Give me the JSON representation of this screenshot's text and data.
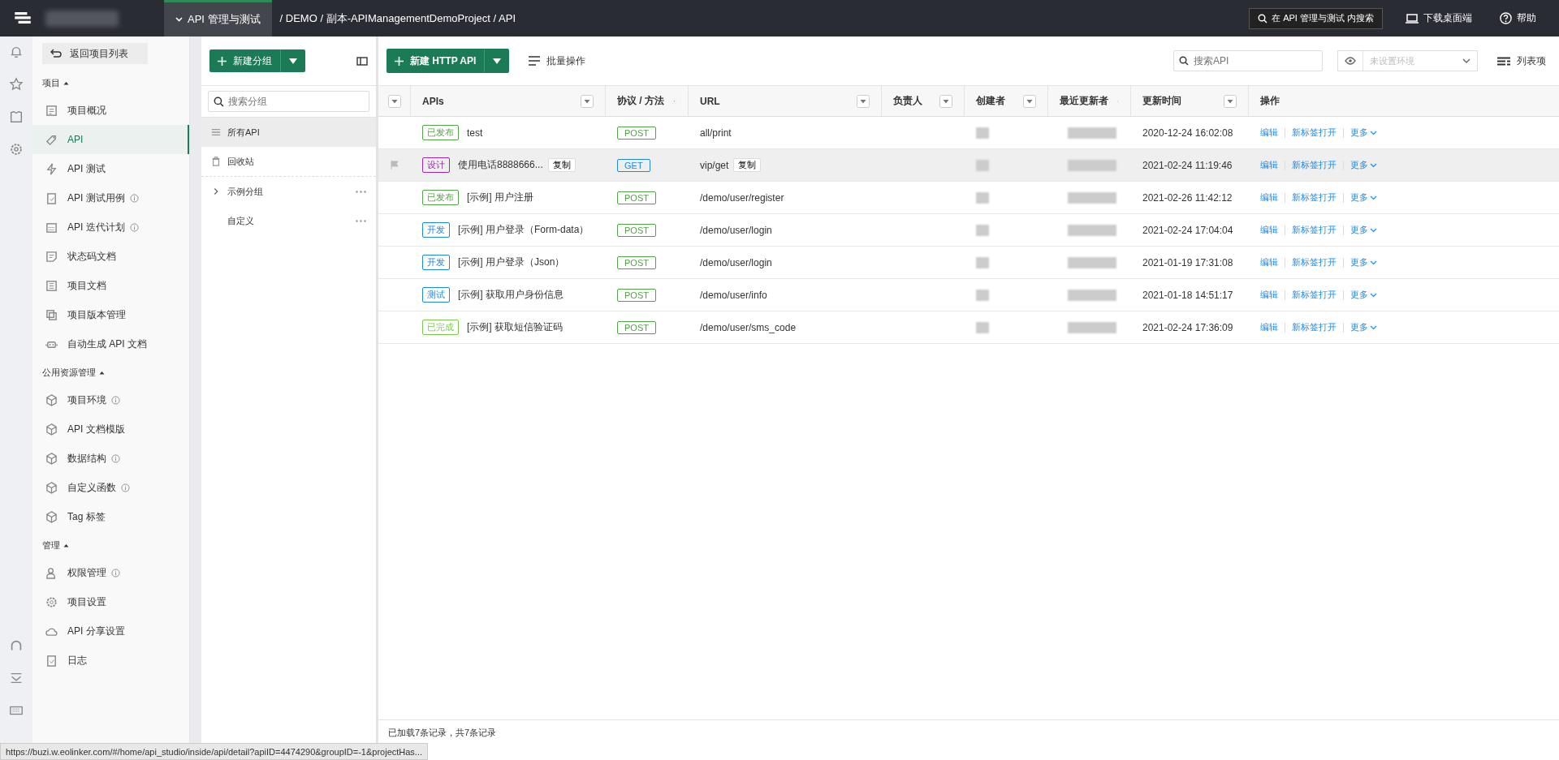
{
  "topbar": {
    "module": "API 管理与测试",
    "breadcrumb": "/ DEMO / 副本-APIManagementDemoProject / API",
    "search": "在 API 管理与测试 内搜索",
    "download": "下载桌面端",
    "help": "帮助"
  },
  "sidebar": {
    "back": "返回项目列表",
    "sections": [
      {
        "title": "项目",
        "items": [
          {
            "label": "项目概况",
            "info": false,
            "selected": false
          },
          {
            "label": "API",
            "info": false,
            "selected": true
          },
          {
            "label": "API 测试",
            "info": false,
            "selected": false
          },
          {
            "label": "API 测试用例",
            "info": true,
            "selected": false
          },
          {
            "label": "API 迭代计划",
            "info": true,
            "selected": false
          },
          {
            "label": "状态码文档",
            "info": false,
            "selected": false
          },
          {
            "label": "项目文档",
            "info": false,
            "selected": false
          },
          {
            "label": "项目版本管理",
            "info": false,
            "selected": false
          },
          {
            "label": "自动生成 API 文档",
            "info": false,
            "selected": false
          }
        ]
      },
      {
        "title": "公用资源管理",
        "items": [
          {
            "label": "项目环境",
            "info": true,
            "selected": false
          },
          {
            "label": "API 文档模版",
            "info": false,
            "selected": false
          },
          {
            "label": "数据结构",
            "info": true,
            "selected": false
          },
          {
            "label": "自定义函数",
            "info": true,
            "selected": false
          },
          {
            "label": "Tag 标签",
            "info": false,
            "selected": false
          }
        ]
      },
      {
        "title": "管理",
        "items": [
          {
            "label": "权限管理",
            "info": true,
            "selected": false
          },
          {
            "label": "项目设置",
            "info": false,
            "selected": false
          },
          {
            "label": "API 分享设置",
            "info": false,
            "selected": false
          },
          {
            "label": "日志",
            "info": false,
            "selected": false
          }
        ]
      }
    ]
  },
  "groups": {
    "new_button": "新建分组",
    "search_placeholder": "搜索分组",
    "items": [
      {
        "label": "所有API",
        "kind": "all",
        "selected": true
      },
      {
        "label": "回收站",
        "kind": "trash",
        "selected": false
      },
      {
        "label": "示例分组",
        "kind": "folder",
        "selected": false
      },
      {
        "label": "自定义",
        "kind": "custom",
        "selected": false
      }
    ]
  },
  "toolbar": {
    "new_api": "新建 HTTP API",
    "batch": "批量操作",
    "search_placeholder": "搜索API",
    "env_placeholder": "未设置环境",
    "columns": "列表项"
  },
  "table": {
    "columns": [
      "APIs",
      "协议 / 方法",
      "URL",
      "负责人",
      "创建者",
      "最近更新者",
      "更新时间",
      "操作"
    ],
    "rows": [
      {
        "selected": false,
        "status": {
          "label": "已发布",
          "color": "#52a447"
        },
        "name": "test",
        "method": {
          "label": "POST",
          "color": "#52a447"
        },
        "url": "all/print",
        "time": "2020-12-24 16:02:08",
        "actions": [
          "编辑",
          "新标签打开",
          "更多"
        ]
      },
      {
        "selected": true,
        "status": {
          "label": "设计",
          "color": "#9c27b0"
        },
        "name": "使用电话8888666...",
        "name_copy": "复制",
        "method": {
          "label": "GET",
          "color": "#1e88e5"
        },
        "url": "vip/get",
        "url_copy": "复制",
        "time": "2021-02-24 11:19:46",
        "actions": [
          "编辑",
          "新标签打开",
          "更多"
        ]
      },
      {
        "selected": false,
        "status": {
          "label": "已发布",
          "color": "#52a447"
        },
        "name": "[示例] 用户注册",
        "method": {
          "label": "POST",
          "color": "#52a447"
        },
        "url": "/demo/user/register",
        "time": "2021-02-26 11:42:12",
        "actions": [
          "编辑",
          "新标签打开",
          "更多"
        ]
      },
      {
        "selected": false,
        "status": {
          "label": "开发",
          "color": "#1e88e5"
        },
        "name": "[示例] 用户登录（Form-data）",
        "method": {
          "label": "POST",
          "color": "#52a447"
        },
        "url": "/demo/user/login",
        "time": "2021-02-24 17:04:04",
        "actions": [
          "编辑",
          "新标签打开",
          "更多"
        ]
      },
      {
        "selected": false,
        "status": {
          "label": "开发",
          "color": "#1e88e5"
        },
        "name": "[示例] 用户登录（Json）",
        "method": {
          "label": "POST",
          "color": "#52a447"
        },
        "url": "/demo/user/login",
        "time": "2021-01-19 17:31:08",
        "actions": [
          "编辑",
          "新标签打开",
          "更多"
        ]
      },
      {
        "selected": false,
        "status": {
          "label": "测试",
          "color": "#1e88e5"
        },
        "name": "[示例] 获取用户身份信息",
        "method": {
          "label": "POST",
          "color": "#52a447"
        },
        "url": "/demo/user/info",
        "time": "2021-01-18 14:51:17",
        "actions": [
          "编辑",
          "新标签打开",
          "更多"
        ]
      },
      {
        "selected": false,
        "status": {
          "label": "已完成",
          "color": "#7cc84f"
        },
        "name": "[示例] 获取短信验证码",
        "method": {
          "label": "POST",
          "color": "#52a447"
        },
        "url": "/demo/user/sms_code",
        "time": "2021-02-24 17:36:09",
        "actions": [
          "编辑",
          "新标签打开",
          "更多"
        ]
      }
    ]
  },
  "footer": "已加载7条记录，共7条记录",
  "status_bar": "https://buzi.w.eolinker.com/#/home/api_studio/inside/api/detail?apiID=4474290&groupID=-1&projectHas..."
}
